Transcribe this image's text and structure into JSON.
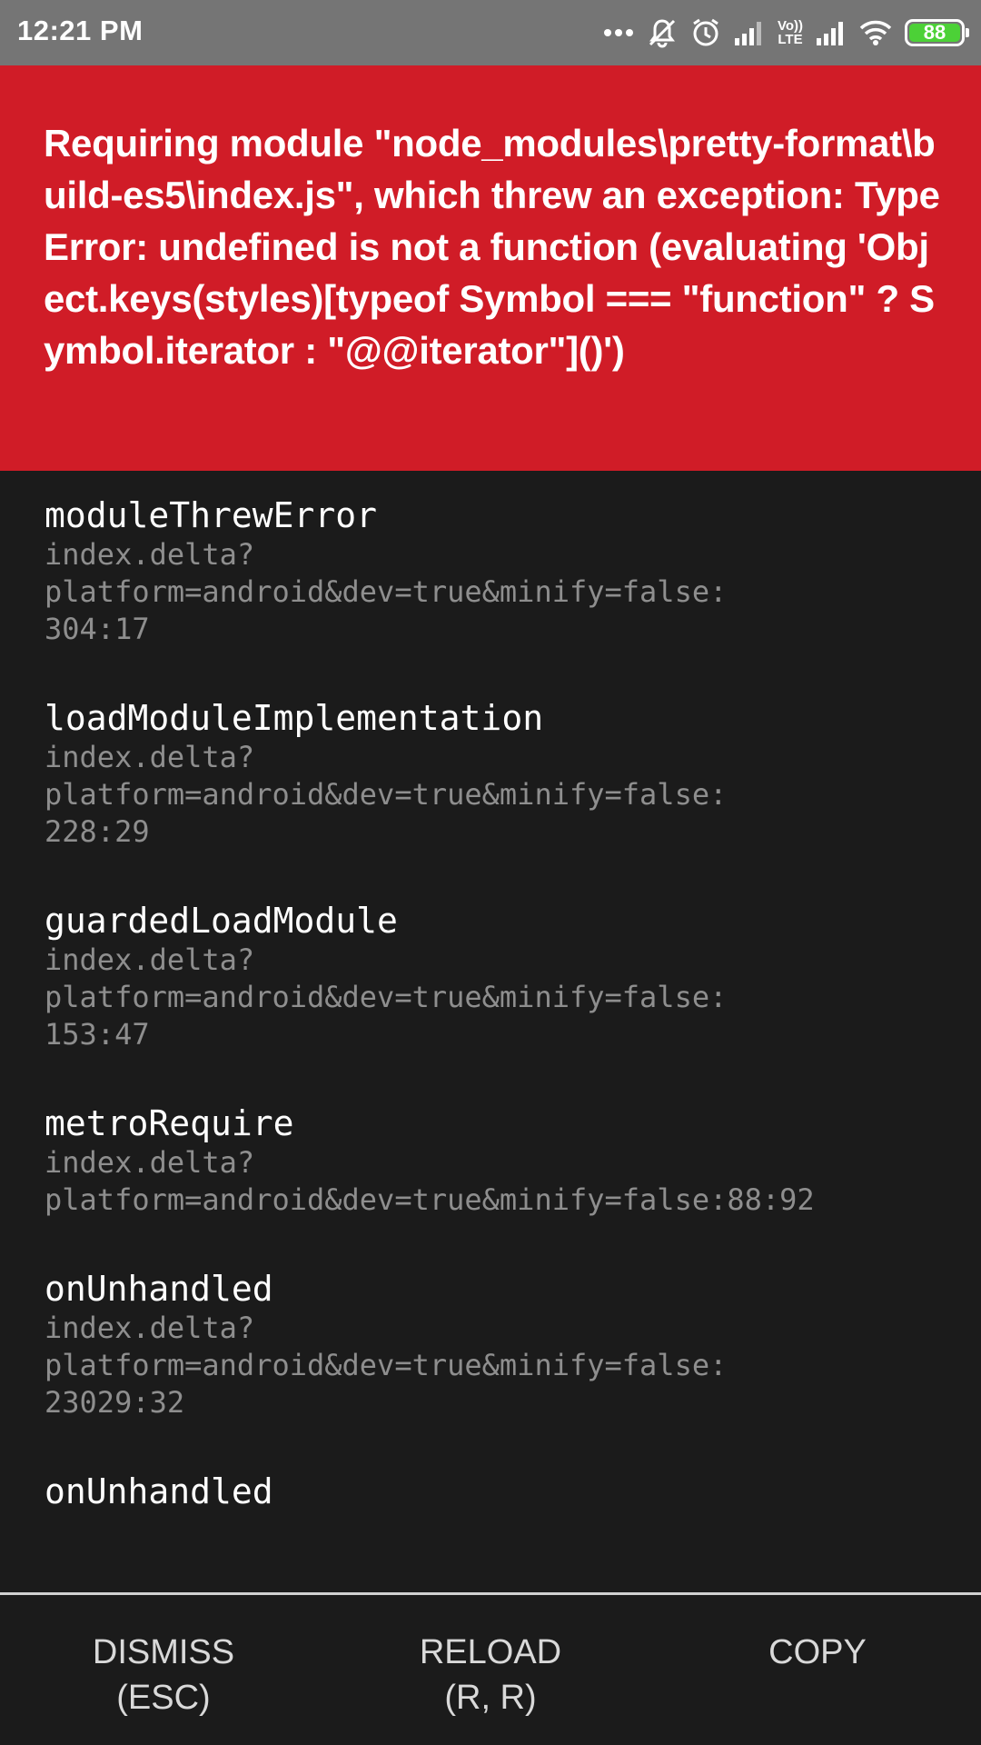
{
  "status_bar": {
    "time": "12:21 PM",
    "volte_line1": "Vo))",
    "volte_line2": "LTE",
    "battery_level": "88",
    "icons": [
      "more-dots-icon",
      "notifications-off-icon",
      "alarm-icon",
      "signal-icon",
      "volte-icon",
      "signal-icon",
      "wifi-icon",
      "battery-icon"
    ],
    "battery_color": "#4cd137"
  },
  "error": {
    "message": "Requiring module \"node_modules\\pretty-format\\build-es5\\index.js\", which threw an exception: TypeError: undefined is not a function (evaluating 'Object.keys(styles)[typeof Symbol === \"function\" ? Symbol.iterator : \"@@iterator\"]()')",
    "background_color": "#d01c27"
  },
  "stack": [
    {
      "method": "moduleThrewError",
      "location": "index.delta?\nplatform=android&dev=true&minify=false:\n304:17"
    },
    {
      "method": "loadModuleImplementation",
      "location": "index.delta?\nplatform=android&dev=true&minify=false:\n228:29"
    },
    {
      "method": "guardedLoadModule",
      "location": "index.delta?\nplatform=android&dev=true&minify=false:\n153:47"
    },
    {
      "method": "metroRequire",
      "location": "index.delta?\nplatform=android&dev=true&minify=false:88:92"
    },
    {
      "method": "onUnhandled",
      "location": "index.delta?\nplatform=android&dev=true&minify=false:\n23029:32"
    },
    {
      "method": "onUnhandled",
      "location": ""
    }
  ],
  "buttons": {
    "dismiss": "DISMISS\n(ESC)",
    "reload": "RELOAD\n(R, R)",
    "copy": "COPY"
  }
}
